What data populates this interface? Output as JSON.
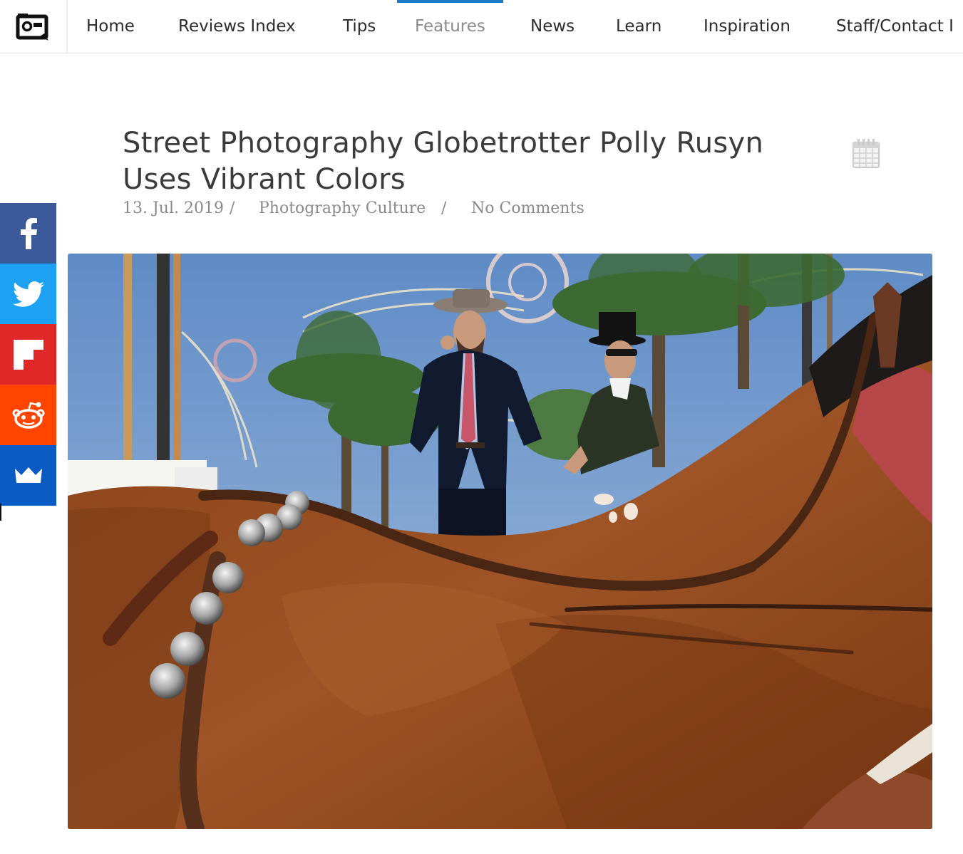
{
  "nav": {
    "items": [
      {
        "label": "Home"
      },
      {
        "label": "Reviews Index"
      },
      {
        "label": "Tips"
      },
      {
        "label": "Features"
      },
      {
        "label": "News"
      },
      {
        "label": "Learn"
      },
      {
        "label": "Inspiration"
      },
      {
        "label": "Staff/Contact I"
      }
    ],
    "active_item": "Features",
    "active_color": "#1e78c8"
  },
  "article": {
    "title_line1": "Street Photography Globetrotter Polly Rusyn",
    "title_line2": "Uses Vibrant Colors",
    "date": "13. Jul. 2019",
    "separator": "/",
    "category": "Photography Culture",
    "comments": "No Comments",
    "calendar_icon": "calendar-icon"
  },
  "share": {
    "buttons": [
      {
        "network": "facebook",
        "icon": "facebook-icon",
        "color": "#3b5998"
      },
      {
        "network": "twitter",
        "icon": "twitter-icon",
        "color": "#1da1f2"
      },
      {
        "network": "flipboard",
        "icon": "flipboard-icon",
        "color": "#e12828"
      },
      {
        "network": "reddit",
        "icon": "reddit-icon",
        "color": "#ff4500"
      },
      {
        "network": "sumo",
        "icon": "crown-icon",
        "color": "#0a5cc4"
      }
    ]
  },
  "hero": {
    "icon": "photo-horse-riders"
  }
}
